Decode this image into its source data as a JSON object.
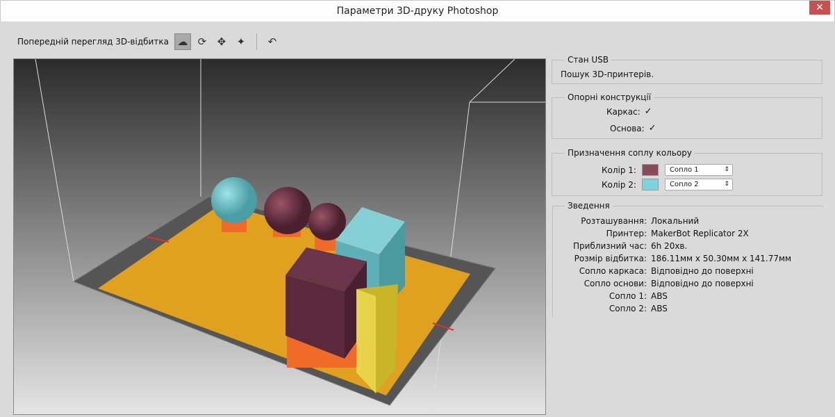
{
  "window": {
    "title": "Параметри 3D-друку Photoshop",
    "close_icon": "close-icon"
  },
  "toolbar": {
    "label": "Попередній перегляд 3D-відбитка",
    "tools": [
      "scene-view-icon",
      "rotate-icon",
      "pan-icon",
      "move-icon",
      "reset-view-icon"
    ]
  },
  "usb": {
    "title": "Стан USB",
    "status": "Пошук 3D-принтерів."
  },
  "supports": {
    "title": "Опорні конструкції",
    "frame_label": "Каркас:",
    "frame_checked": true,
    "base_label": "Основа:",
    "base_checked": true
  },
  "nozzle": {
    "title": "Призначення соплу кольору",
    "color1_label": "Колір 1:",
    "color1": "#8a4a5e",
    "color1_value": "Сопло 1",
    "color2_label": "Колір 2:",
    "color2": "#7fd3df",
    "color2_value": "Сопло 2"
  },
  "summary": {
    "title": "Зведення",
    "rows": [
      {
        "k": "Розташування:",
        "v": "Локальний"
      },
      {
        "k": "Принтер:",
        "v": "MakerBot Replicator 2X"
      },
      {
        "k": "Приблизний час:",
        "v": "6h 20хв."
      },
      {
        "k": "Розмір відбитка:",
        "v": "186.11мм x 50.30мм x 141.77мм"
      },
      {
        "k": "Сопло каркаса:",
        "v": "Відповідно до поверхні"
      },
      {
        "k": "Сопло основи:",
        "v": "Відповідно до поверхні"
      },
      {
        "k": "Сопло 1:",
        "v": "ABS"
      },
      {
        "k": "Сопло 2:",
        "v": "ABS"
      }
    ]
  }
}
